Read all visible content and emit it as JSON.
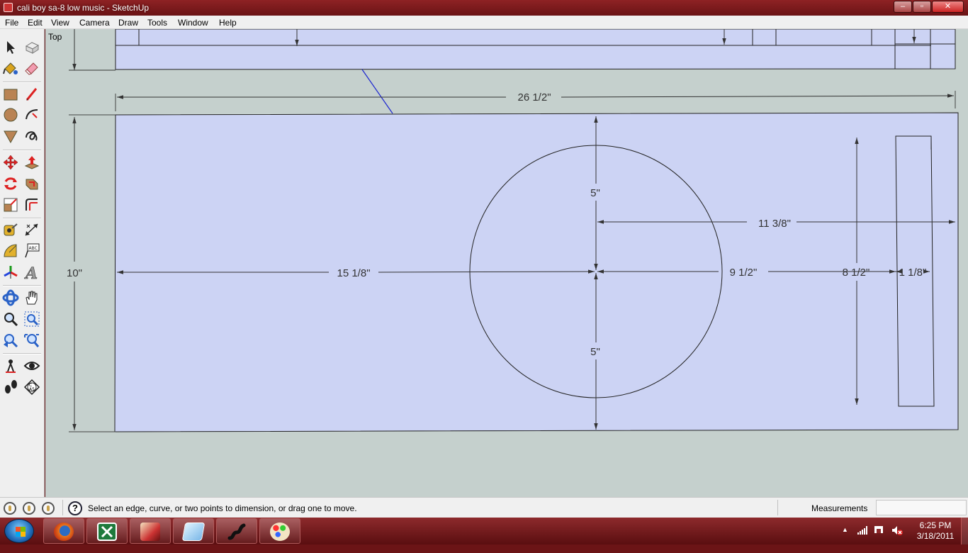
{
  "window": {
    "title": "cali boy sa-8 low music - SketchUp",
    "minimize": "–",
    "maximize": "▫",
    "close": "✕"
  },
  "menu": [
    "File",
    "Edit",
    "View",
    "Camera",
    "Draw",
    "Tools",
    "Window",
    "Help"
  ],
  "viewport": {
    "view_name": "Top",
    "dimensions": {
      "overall_length": "26 1/2\"",
      "height": "10\"",
      "left_to_center": "15 1/8\"",
      "center_to_top": "5\"",
      "center_to_bottom": "5\"",
      "center_to_right": "11 3/8\"",
      "center_to_inner": "9 1/2\"",
      "inner_height": "8 1/2\"",
      "inner_width": "1 1/8\""
    }
  },
  "statusbar": {
    "hint": "Select an edge, curve, or two points to dimension, or drag one to move.",
    "help_icon": "?",
    "measurements_label": "Measurements",
    "measurements_value": ""
  },
  "taskbar": {
    "clock_time": "6:25 PM",
    "clock_date": "3/18/2011",
    "tray_arrow": "▲"
  },
  "colors": {
    "face": "#ccd3f4",
    "canvas": "#c5d0cd",
    "taskbar": "#7a1c1e"
  }
}
